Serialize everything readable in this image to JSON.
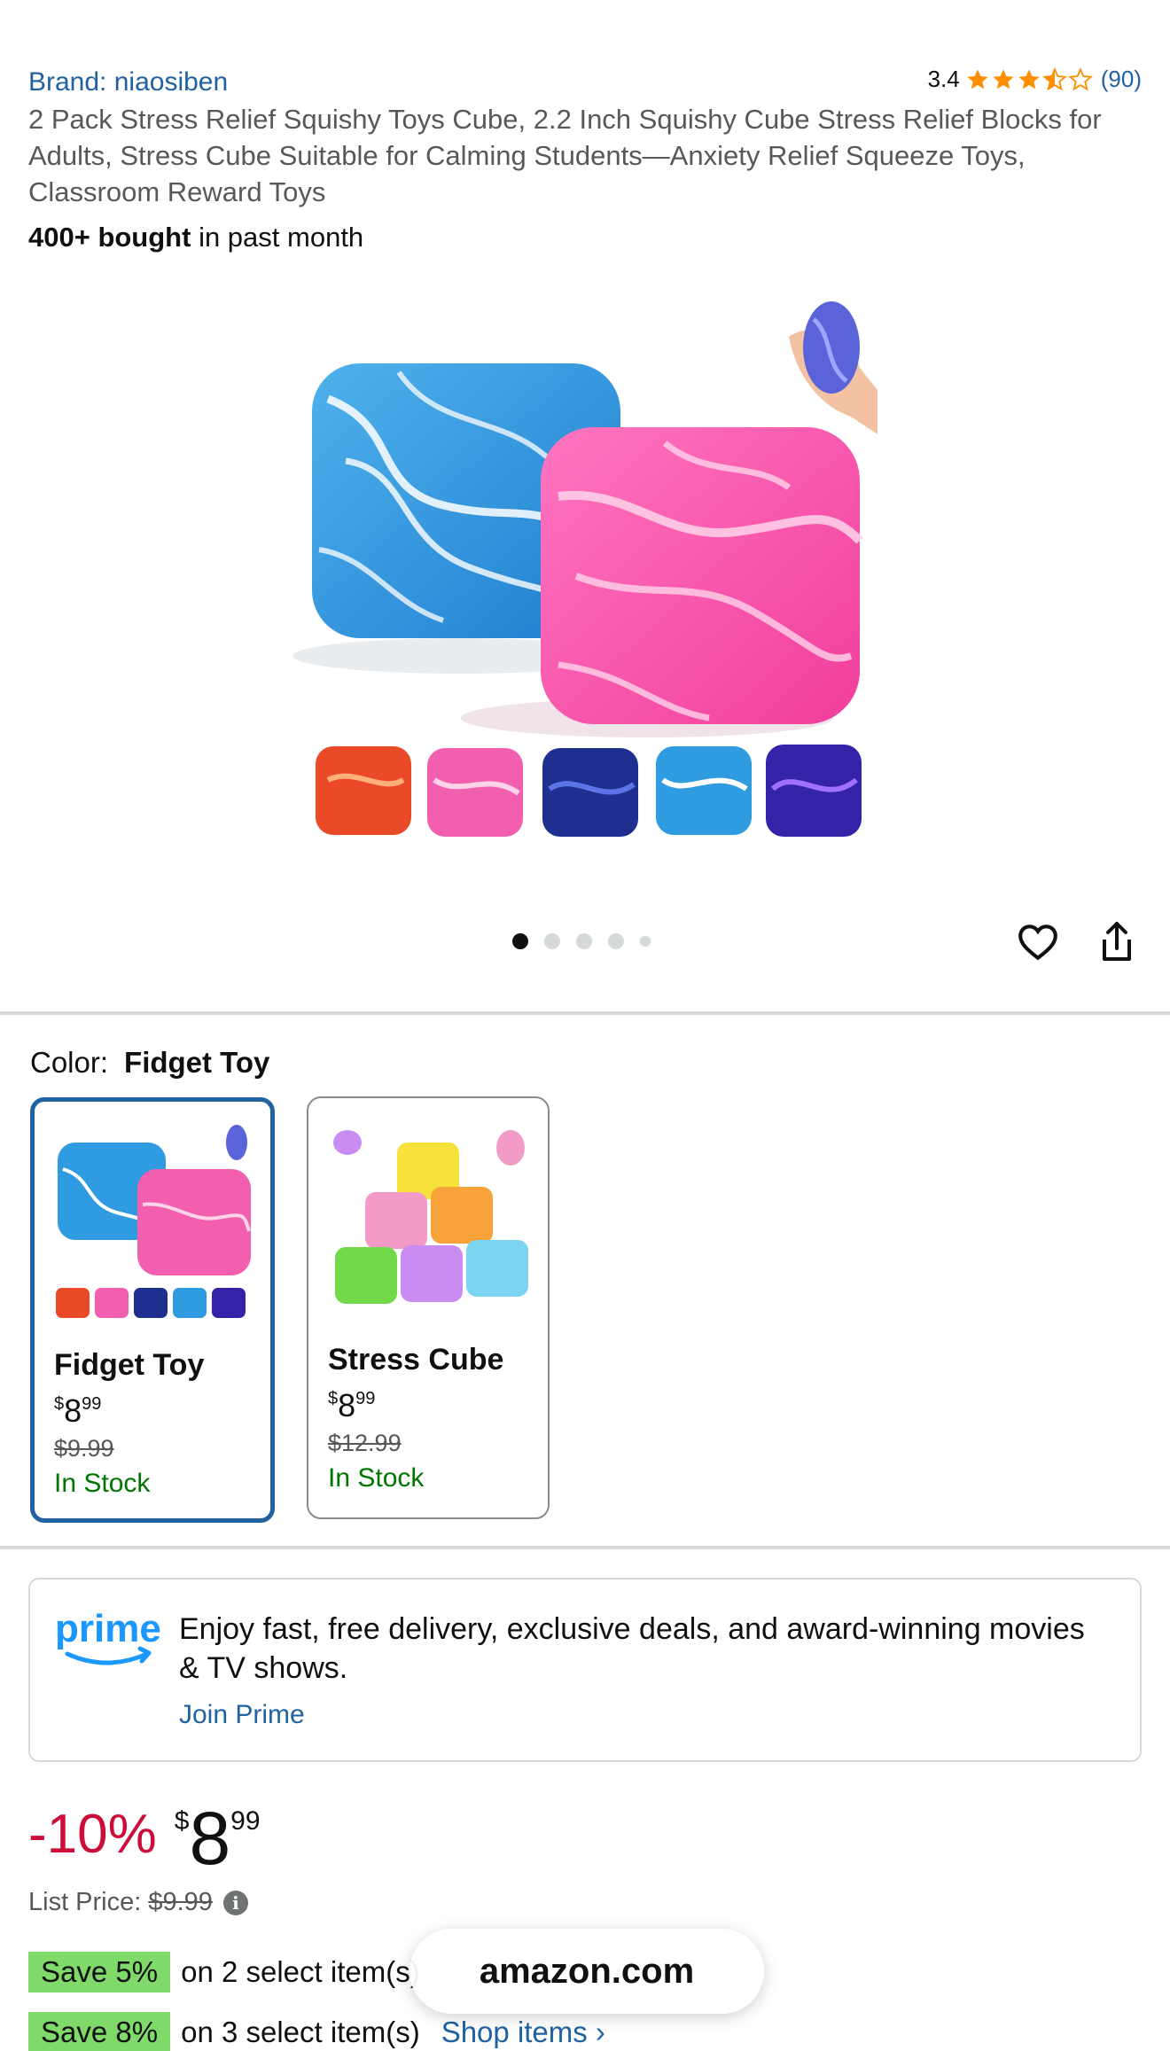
{
  "product": {
    "brand": "Brand: niaosiben",
    "rating": "3.4",
    "rating_count": "(90)",
    "title": "2 Pack Stress Relief Squishy Toys Cube, 2.2 Inch Squishy Cube Stress Relief Blocks for Adults, Stress Cube Suitable for Calming Students—Anxiety Relief Squeeze Toys, Classroom Reward Toys",
    "bought_bold": "400+ bought",
    "bought_rest": " in past month"
  },
  "gallery": {
    "image_count": 5,
    "active_index": 0
  },
  "color": {
    "label": "Color:",
    "selected": "Fidget Toy",
    "options": [
      {
        "name": "Fidget Toy",
        "currency": "$",
        "whole": "8",
        "fraction": "99",
        "list_price": "$9.99",
        "stock": "In Stock"
      },
      {
        "name": "Stress Cube",
        "currency": "$",
        "whole": "8",
        "fraction": "99",
        "list_price": "$12.99",
        "stock": "In Stock"
      }
    ]
  },
  "prime": {
    "logo_text": "prime",
    "message": "Enjoy fast, free delivery, exclusive deals, and award-winning movies & TV shows.",
    "join": "Join Prime"
  },
  "price": {
    "discount": "-10%",
    "currency": "$",
    "whole": "8",
    "fraction": "99",
    "list_label": "List Price:",
    "list_value": "$9.99",
    "info": "i"
  },
  "promos": [
    {
      "badge": "Save 5%",
      "text": "on 2 select item(s)"
    },
    {
      "badge": "Save 8%",
      "text": "on 3 select item(s)",
      "link": "Shop items ›"
    }
  ],
  "overlay": {
    "site": "amazon.com"
  },
  "colors": {
    "link": "#2162a1",
    "star": "#ff8f00",
    "discount": "#cc0c39",
    "stock": "#007600",
    "save_badge": "#7fda69"
  }
}
